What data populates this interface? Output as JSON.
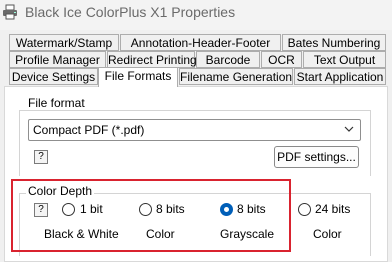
{
  "window": {
    "title": "Black Ice ColorPlus X1 Properties",
    "icon": "printer-icon"
  },
  "tabs_row1": [
    {
      "label": "Watermark/Stamp"
    },
    {
      "label": "Annotation-Header-Footer"
    },
    {
      "label": "Bates Numbering"
    }
  ],
  "tabs_row2": [
    {
      "label": "Profile Manager"
    },
    {
      "label": "Redirect Printing"
    },
    {
      "label": "Barcode"
    },
    {
      "label": "OCR"
    },
    {
      "label": "Text Output"
    }
  ],
  "tabs_row3": [
    {
      "label": "Device Settings"
    },
    {
      "label": "File Formats",
      "active": true
    },
    {
      "label": "Filename Generation"
    },
    {
      "label": "Start Application"
    }
  ],
  "file_format": {
    "legend": "File format",
    "selected": "Compact PDF (*.pdf)",
    "help_label": "?",
    "settings_button": "PDF settings..."
  },
  "color_depth": {
    "legend": "Color Depth",
    "help_label": "?",
    "options": [
      {
        "label": "1 bit",
        "sublabel": "Black & White",
        "checked": false
      },
      {
        "label": "8 bits",
        "sublabel": "Color",
        "checked": false
      },
      {
        "label": "8 bits",
        "sublabel": "Grayscale",
        "checked": true
      },
      {
        "label": "24 bits",
        "sublabel": "Color",
        "checked": false
      }
    ]
  },
  "colors": {
    "highlight": "#d9232f",
    "radio_checked": "#005fb8"
  }
}
